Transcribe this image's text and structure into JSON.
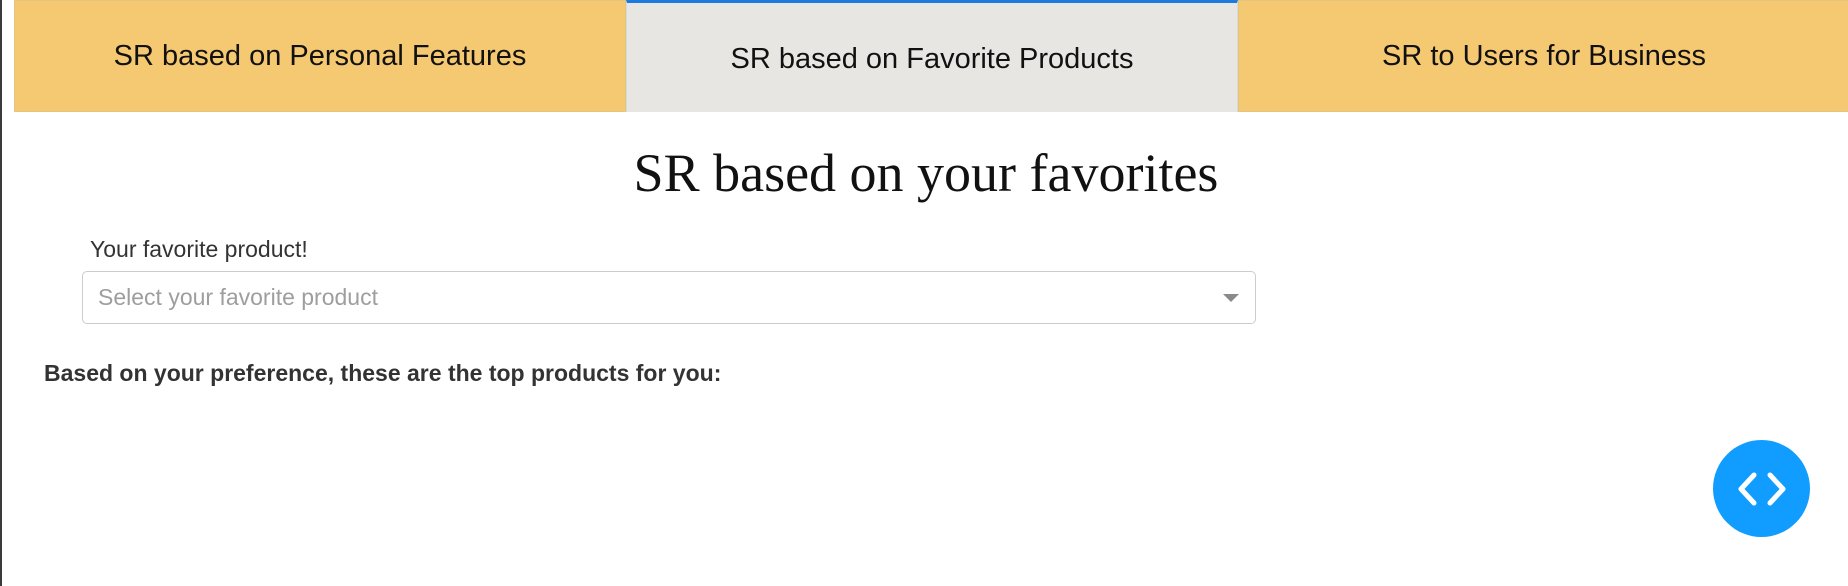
{
  "tabs": [
    {
      "label": "SR based on Personal Features",
      "active": false
    },
    {
      "label": "SR based on Favorite Products",
      "active": true
    },
    {
      "label": "SR to Users for Business",
      "active": false
    }
  ],
  "main": {
    "title": "SR based on your favorites",
    "favorite_field": {
      "label": "Your favorite product!",
      "placeholder": "Select your favorite product",
      "value": ""
    },
    "results_heading": "Based on your preference, these are the top products for you:"
  },
  "fab": {
    "icon": "code-icon",
    "color": "#119dff"
  },
  "colors": {
    "tab_inactive": "#f5c872",
    "tab_active": "#e8e6e3",
    "tab_active_indicator": "#1f7ae0"
  }
}
